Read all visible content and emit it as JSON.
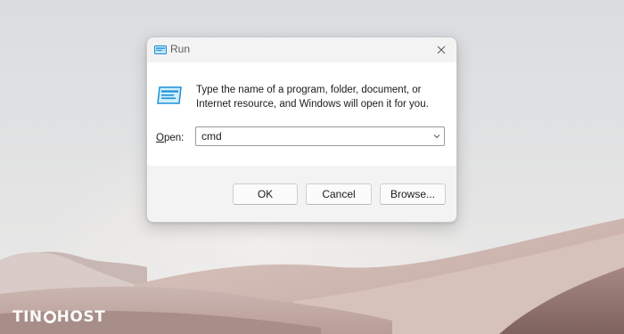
{
  "window": {
    "title": "Run",
    "title_icon": "run-icon",
    "close_icon": "close-icon"
  },
  "dialog": {
    "message": "Type the name of a program, folder, document, or Internet resource, and Windows will open it for you.",
    "open_label_accel": "O",
    "open_label_rest": "pen:",
    "input_value": "cmd",
    "dropdown_icon": "chevron-down-icon"
  },
  "buttons": {
    "ok": "OK",
    "cancel": "Cancel",
    "browse": "Browse..."
  },
  "watermark": {
    "part1": "TIN",
    "part2": "HOST"
  },
  "colors": {
    "accent": "#1e90d6",
    "dialog_bg": "#f3f3f3",
    "content_bg": "#ffffff"
  }
}
